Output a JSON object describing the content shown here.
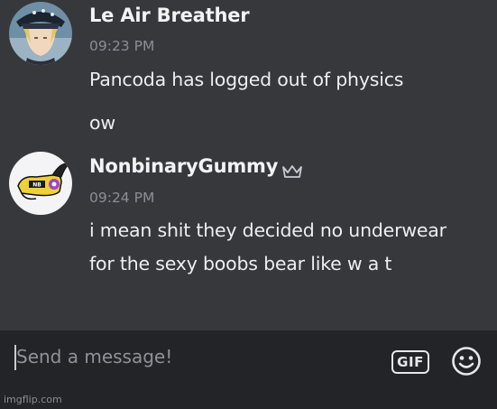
{
  "messages": [
    {
      "username": "Le Air Breather",
      "timestamp": "09:23 PM",
      "lines": [
        "Pancoda has logged out of physics",
        "ow"
      ],
      "has_crown": false,
      "avatar_icon": "anime-character-avatar"
    },
    {
      "username": "NonbinaryGummy",
      "timestamp": "09:24 PM",
      "lines": [
        "i mean shit they decided no underwear",
        "for the sexy boobs bear like w a t"
      ],
      "has_crown": true,
      "avatar_icon": "gummy-character-avatar"
    }
  ],
  "composer": {
    "placeholder": "Send a message!",
    "gif_label": "GIF",
    "emoji_icon": "smiley-icon"
  },
  "watermark": "imgflip.com",
  "colors": {
    "chat_bg": "#36383c",
    "composer_bg": "#232427",
    "username": "#f2f3f5",
    "timestamp": "#8b8e94",
    "text": "#eceef0"
  }
}
